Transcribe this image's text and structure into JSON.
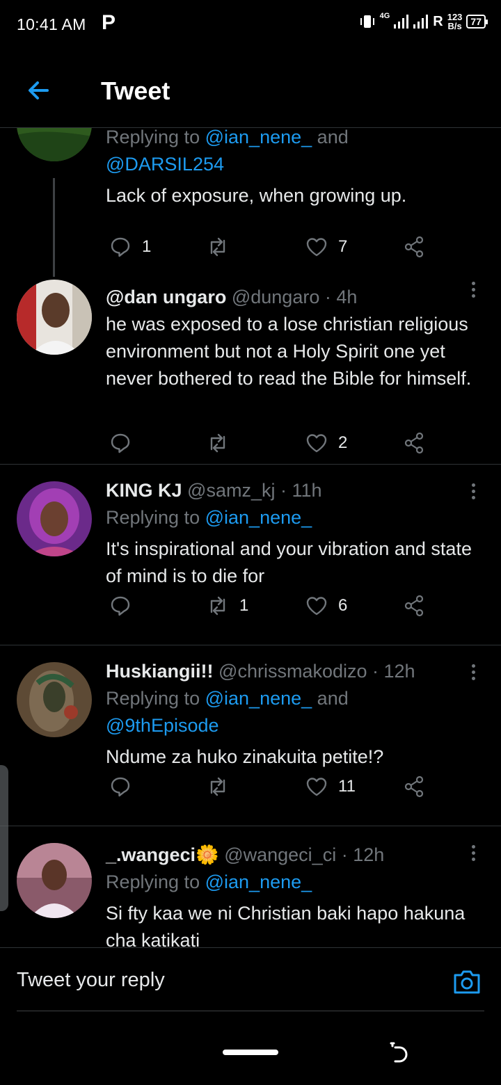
{
  "status_bar": {
    "time": "10:41 AM",
    "app_icon": "P",
    "network": "4G",
    "roaming": "R",
    "speed_value": "123",
    "speed_unit": "B/s",
    "battery": "77"
  },
  "header": {
    "title": "Tweet",
    "back_icon": "arrow-left-icon"
  },
  "colors": {
    "accent": "#1d9bf0",
    "background": "#000000",
    "secondary_text": "#71767b"
  },
  "tweets": [
    {
      "name": "",
      "handle": "",
      "time": "",
      "replying_prefix": "Replying to",
      "mentions": [
        "@ian_nene_",
        "@DARSIL254"
      ],
      "connector": "and",
      "text": "Lack of exposure, when growing up.",
      "replies": "1",
      "retweets": "",
      "likes": "7"
    },
    {
      "name": "@dan ungaro",
      "handle": "@dungaro",
      "time": "· 4h",
      "text": "he was exposed to a lose christian religious environment but not a Holy Spirit one yet never bothered to read the Bible for himself.",
      "replies": "",
      "retweets": "",
      "likes": "2"
    },
    {
      "name": "KING KJ",
      "handle": "@samz_kj",
      "time": "· 11h",
      "replying_prefix": "Replying to",
      "mentions": [
        "@ian_nene_"
      ],
      "text": "It's inspirational and your vibration and state of mind is to die for",
      "replies": "",
      "retweets": "1",
      "likes": "6"
    },
    {
      "name": "Huskiangii!!",
      "handle": "@chrissmakodizo",
      "time": "· 12h",
      "replying_prefix": "Replying to",
      "mentions": [
        "@ian_nene_",
        "@9thEpisode"
      ],
      "connector": "and",
      "text": "Ndume za huko zinakuita petite!?",
      "replies": "",
      "retweets": "",
      "likes": "11"
    },
    {
      "name": "_.wangeci",
      "name_emoji": "🌼",
      "handle": "@wangeci_ci",
      "time": "· 12h",
      "replying_prefix": "Replying to",
      "mentions": [
        "@ian_nene_"
      ],
      "text": "Si fty kaa we ni Christian baki hapo hakuna cha katikati"
    }
  ],
  "reply_bar": {
    "placeholder": "Tweet your reply",
    "camera_icon": "camera-icon"
  }
}
